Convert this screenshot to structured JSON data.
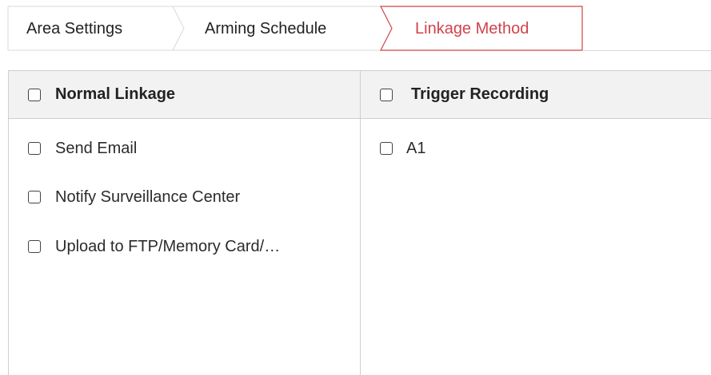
{
  "tabs": {
    "area_settings": "Area Settings",
    "arming_schedule": "Arming Schedule",
    "linkage_method": "Linkage Method",
    "active_color": "#d0434b"
  },
  "normal_linkage": {
    "title": "Normal Linkage",
    "items": [
      {
        "label": "Send Email",
        "checked": false
      },
      {
        "label": "Notify Surveillance Center",
        "checked": false
      },
      {
        "label": "Upload to FTP/Memory Card/…",
        "checked": false
      }
    ]
  },
  "trigger_recording": {
    "title": "Trigger Recording",
    "items": [
      {
        "label": "A1",
        "checked": false
      }
    ]
  }
}
